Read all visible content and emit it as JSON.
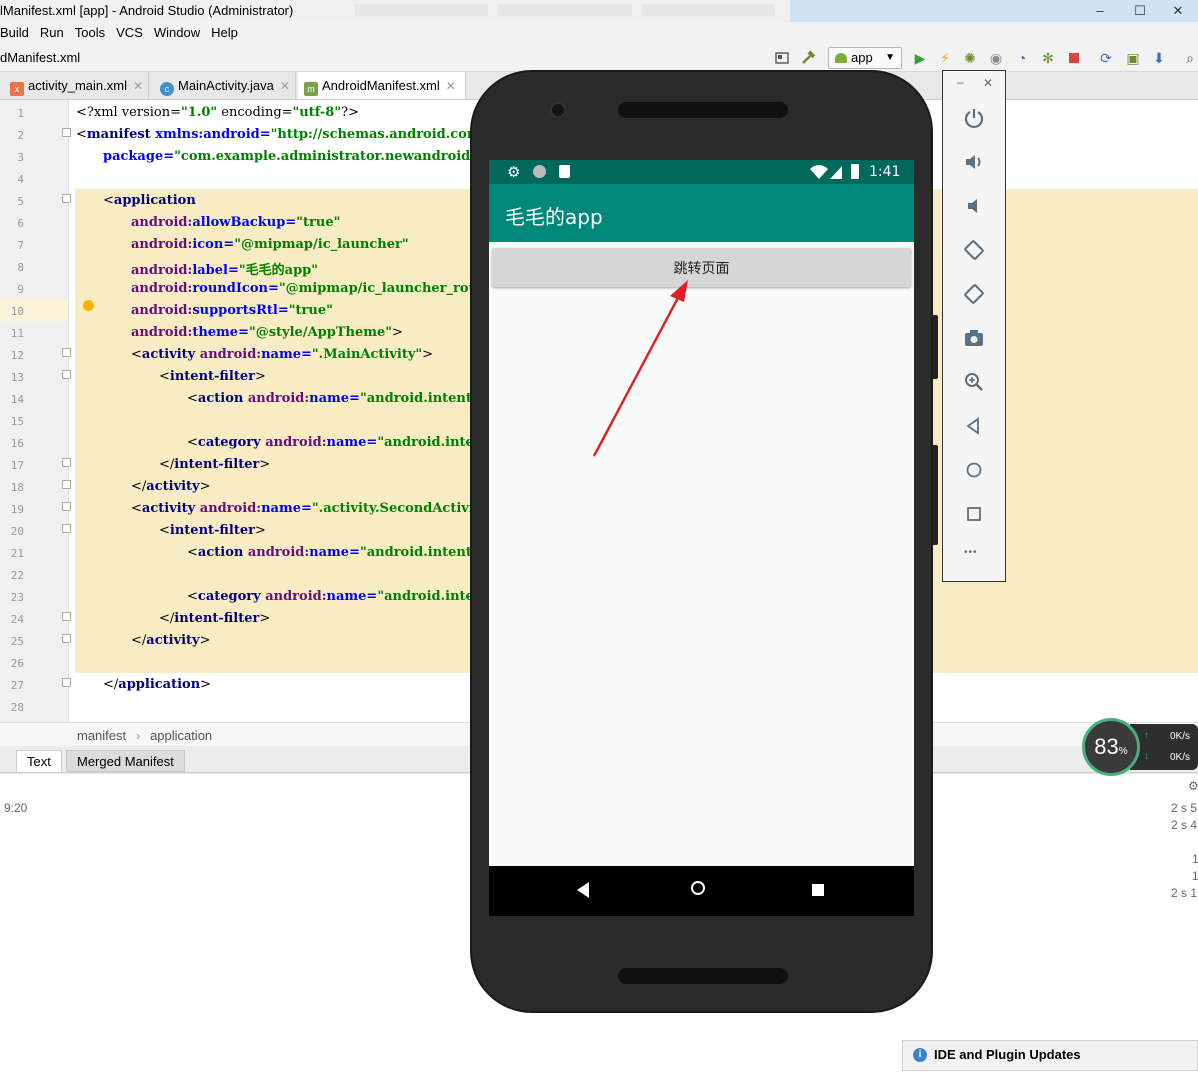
{
  "window": {
    "title": "lManifest.xml [app] - Android Studio (Administrator)",
    "minimize": "–",
    "restore": "☐",
    "close": "✕"
  },
  "menu": [
    "Build",
    "Run",
    "Tools",
    "VCS",
    "Window",
    "Help"
  ],
  "nav": {
    "crumb": "dManifest.xml",
    "run_config": "app"
  },
  "tabs": [
    {
      "label": "activity_main.xml",
      "icon": "xml-file-icon",
      "color": "#e8754a"
    },
    {
      "label": "MainActivity.java",
      "icon": "java-class-icon",
      "color": "#3f8fcf"
    },
    {
      "label": "AndroidManifest.xml",
      "icon": "manifest-file-icon",
      "color": "#7da04b"
    }
  ],
  "code": {
    "line_numbers": [
      "1",
      "2",
      "3",
      "4",
      "5",
      "6",
      "7",
      "8",
      "9",
      "10",
      "11",
      "12",
      "13",
      "14",
      "15",
      "16",
      "17",
      "18",
      "19",
      "20",
      "21",
      "22",
      "23",
      "24",
      "25",
      "26",
      "27",
      "28"
    ],
    "l1_a": "<?xml version=",
    "l1_b": "\"1.0\"",
    "l1_c": " encoding=",
    "l1_d": "\"utf-8\"",
    "l1_e": "?>",
    "l2_a": "<",
    "l2_b": "manifest",
    "l2_c": " xmlns:android=",
    "l2_d": "\"http://schemas.android.com/apk/r",
    "l3_a": "package=",
    "l3_b": "\"com.example.administrator.newandroid\"",
    "l3_c": ">",
    "l5_a": "<",
    "l5_b": "application",
    "l6_a": "android:",
    "l6_b": "allowBackup=",
    "l6_c": "\"true\"",
    "l7_a": "android:",
    "l7_b": "icon=",
    "l7_c": "\"@mipmap/ic_launcher\"",
    "l8_a": "android:",
    "l8_b": "label=",
    "l8_c": "\"毛毛的app\"",
    "l9_a": "android:",
    "l9_b": "roundIcon=",
    "l9_c": "\"@mipmap/ic_launcher_round\"",
    "l10_a": "android:",
    "l10_b": "supportsRtl=",
    "l10_c": "\"true\"",
    "l11_a": "android:",
    "l11_b": "theme=",
    "l11_c": "\"@style/AppTheme\"",
    "l11_d": ">",
    "l12_a": "<",
    "l12_b": "activity",
    "l12_c": " android:",
    "l12_d": "name=",
    "l12_e": "\".MainActivity\"",
    "l12_f": ">",
    "l13_a": "<",
    "l13_b": "intent-filter",
    "l13_c": ">",
    "l14_a": "<",
    "l14_b": "action",
    "l14_c": " android:",
    "l14_d": "name=",
    "l14_e": "\"android.intent.act",
    "l16_a": "<",
    "l16_b": "category",
    "l16_c": " android:",
    "l16_d": "name=",
    "l16_e": "\"android.intent.c",
    "l17_a": "</",
    "l17_b": "intent-filter",
    "l17_c": ">",
    "l18_a": "</",
    "l18_b": "activity",
    "l18_c": ">",
    "l19_a": "<",
    "l19_b": "activity",
    "l19_c": " android:",
    "l19_d": "name=",
    "l19_e": "\".activity.SecondActivity\"",
    "l20_a": "<",
    "l20_b": "intent-filter",
    "l20_c": ">",
    "l21_a": "<",
    "l21_b": "action",
    "l21_c": " android:",
    "l21_d": "name=",
    "l21_e": "\"android.intent.act",
    "l23_a": "<",
    "l23_b": "category",
    "l23_c": " android:",
    "l23_d": "name=",
    "l23_e": "\"android.intent.c",
    "l24_a": "</",
    "l24_b": "intent-filter",
    "l24_c": ">",
    "l25_a": "</",
    "l25_b": "activity",
    "l25_c": ">",
    "l27_a": "</",
    "l27_b": "application",
    "l27_c": ">"
  },
  "breadcrumb": [
    "manifest",
    "application"
  ],
  "bottom_tabs": [
    "Text",
    "Merged Manifest"
  ],
  "lower": {
    "time": "9:20",
    "right_col": [
      "2 s 5",
      "2 s 4",
      "1",
      "1",
      "2 s 1"
    ]
  },
  "emulator": {
    "time": "1:41",
    "app_title": "毛毛的app",
    "button_label": "跳转页面",
    "annotation_color": "#e02020",
    "title_bar_close": "✕",
    "title_bar_min": "–",
    "toolbar_icons": [
      "power-icon",
      "volume-up-icon",
      "volume-down-icon",
      "rotate-left-icon",
      "rotate-right-icon",
      "camera-icon",
      "zoom-icon",
      "back-icon",
      "home-icon",
      "overview-icon",
      "more-icon"
    ],
    "more": "•••"
  },
  "net": {
    "percent": "83",
    "percent_unit": "%",
    "up": "0K/s",
    "down": "0K/s"
  },
  "popup": {
    "title": "IDE and Plugin Updates"
  }
}
